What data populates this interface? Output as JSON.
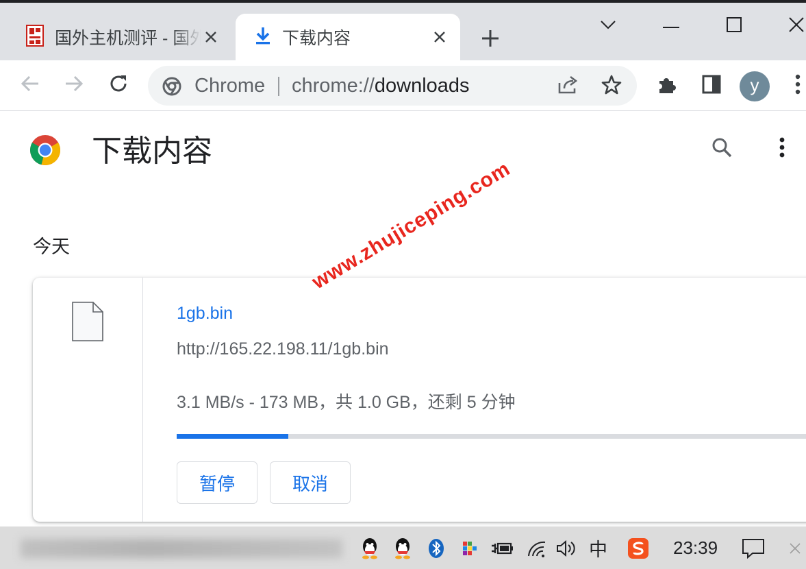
{
  "browser": {
    "tabs": [
      {
        "title": "国外主机测评 - 国外",
        "icon": "site-favicon",
        "active": false
      },
      {
        "title": "下载内容",
        "icon": "download-icon",
        "active": true
      }
    ],
    "new_tab_icon": "plus-icon",
    "window_controls": [
      "chevron-down-icon",
      "minimize-icon",
      "maximize-icon",
      "close-icon"
    ]
  },
  "toolbar": {
    "nav": [
      "back-arrow-icon",
      "forward-arrow-icon",
      "reload-icon"
    ],
    "omnibox": {
      "chip": "Chrome",
      "url_scheme": "chrome://",
      "url_path": "downloads"
    },
    "profile_initial": "y",
    "icons": [
      "share-icon",
      "bookmark-star-icon",
      "extensions-icon",
      "side-panel-icon",
      "menu-kebab-icon"
    ]
  },
  "page": {
    "title": "下载内容",
    "date_label": "今天",
    "header_icons": [
      "search-icon",
      "more-vert-icon"
    ]
  },
  "download": {
    "file_name": "1gb.bin",
    "url": "http://165.22.198.11/1gb.bin",
    "status": "3.1 MB/s - 173 MB，共 1.0 GB，还剩 5 分钟",
    "progress_fraction": 0.17,
    "buttons": {
      "pause": "暂停",
      "cancel": "取消"
    }
  },
  "watermark": "www.zhujiceping.com",
  "taskbar": {
    "ime": "中",
    "clock": "23:39",
    "tray_icons": [
      "qq-icon",
      "qq-icon",
      "bluetooth-icon",
      "app-icon",
      "battery-plug-icon",
      "wifi-icon",
      "volume-icon",
      "sogou-icon",
      "notification-icon"
    ]
  },
  "colors": {
    "accent": "#1a73e8",
    "tabstrip": "#dfe1e5",
    "watermark": "#e8261e",
    "avatar": "#6f8a9a"
  }
}
